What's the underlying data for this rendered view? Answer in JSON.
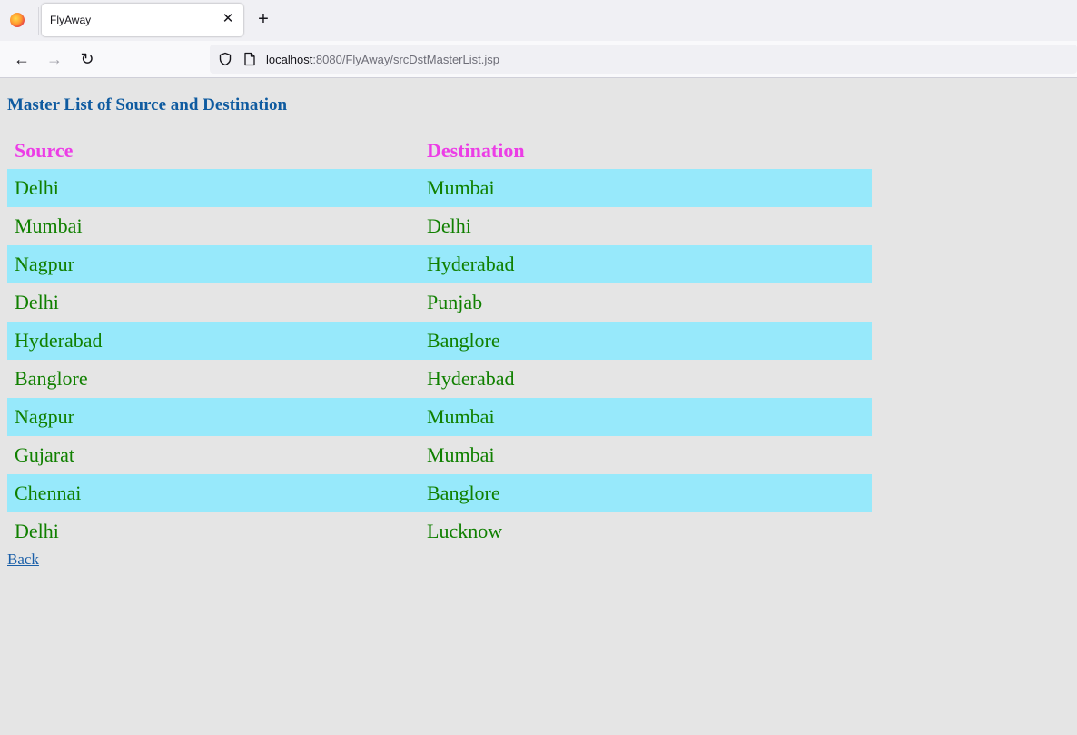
{
  "browser": {
    "tab_title": "FlyAway",
    "tab_close": "✕",
    "new_tab": "+",
    "url_host": "localhost",
    "url_rest": ":8080/FlyAway/srcDstMasterList.jsp",
    "back_glyph": "←",
    "forward_glyph": "→",
    "reload_glyph": "↻"
  },
  "page": {
    "title": "Master List of Source and Destination",
    "back_link": "Back"
  },
  "table": {
    "headers": [
      "Source",
      "Destination"
    ],
    "rows": [
      {
        "source": "Delhi",
        "destination": "Mumbai"
      },
      {
        "source": "Mumbai",
        "destination": "Delhi"
      },
      {
        "source": "Nagpur",
        "destination": "Hyderabad"
      },
      {
        "source": "Delhi",
        "destination": "Punjab"
      },
      {
        "source": "Hyderabad",
        "destination": "Banglore"
      },
      {
        "source": "Banglore",
        "destination": "Hyderabad"
      },
      {
        "source": "Nagpur",
        "destination": "Mumbai"
      },
      {
        "source": "Gujarat",
        "destination": "Mumbai"
      },
      {
        "source": "Chennai",
        "destination": "Banglore"
      },
      {
        "source": "Delhi",
        "destination": "Lucknow"
      }
    ]
  },
  "colors": {
    "title": "#0f5ba0",
    "header_text": "#ec3de6",
    "cell_text": "#108000",
    "stripe": "#97e9fb",
    "page_bg": "#e5e5e5"
  },
  "icons": {
    "browser_logo": "firefox-icon",
    "tracking": "shield-icon",
    "page_info": "page-icon"
  }
}
